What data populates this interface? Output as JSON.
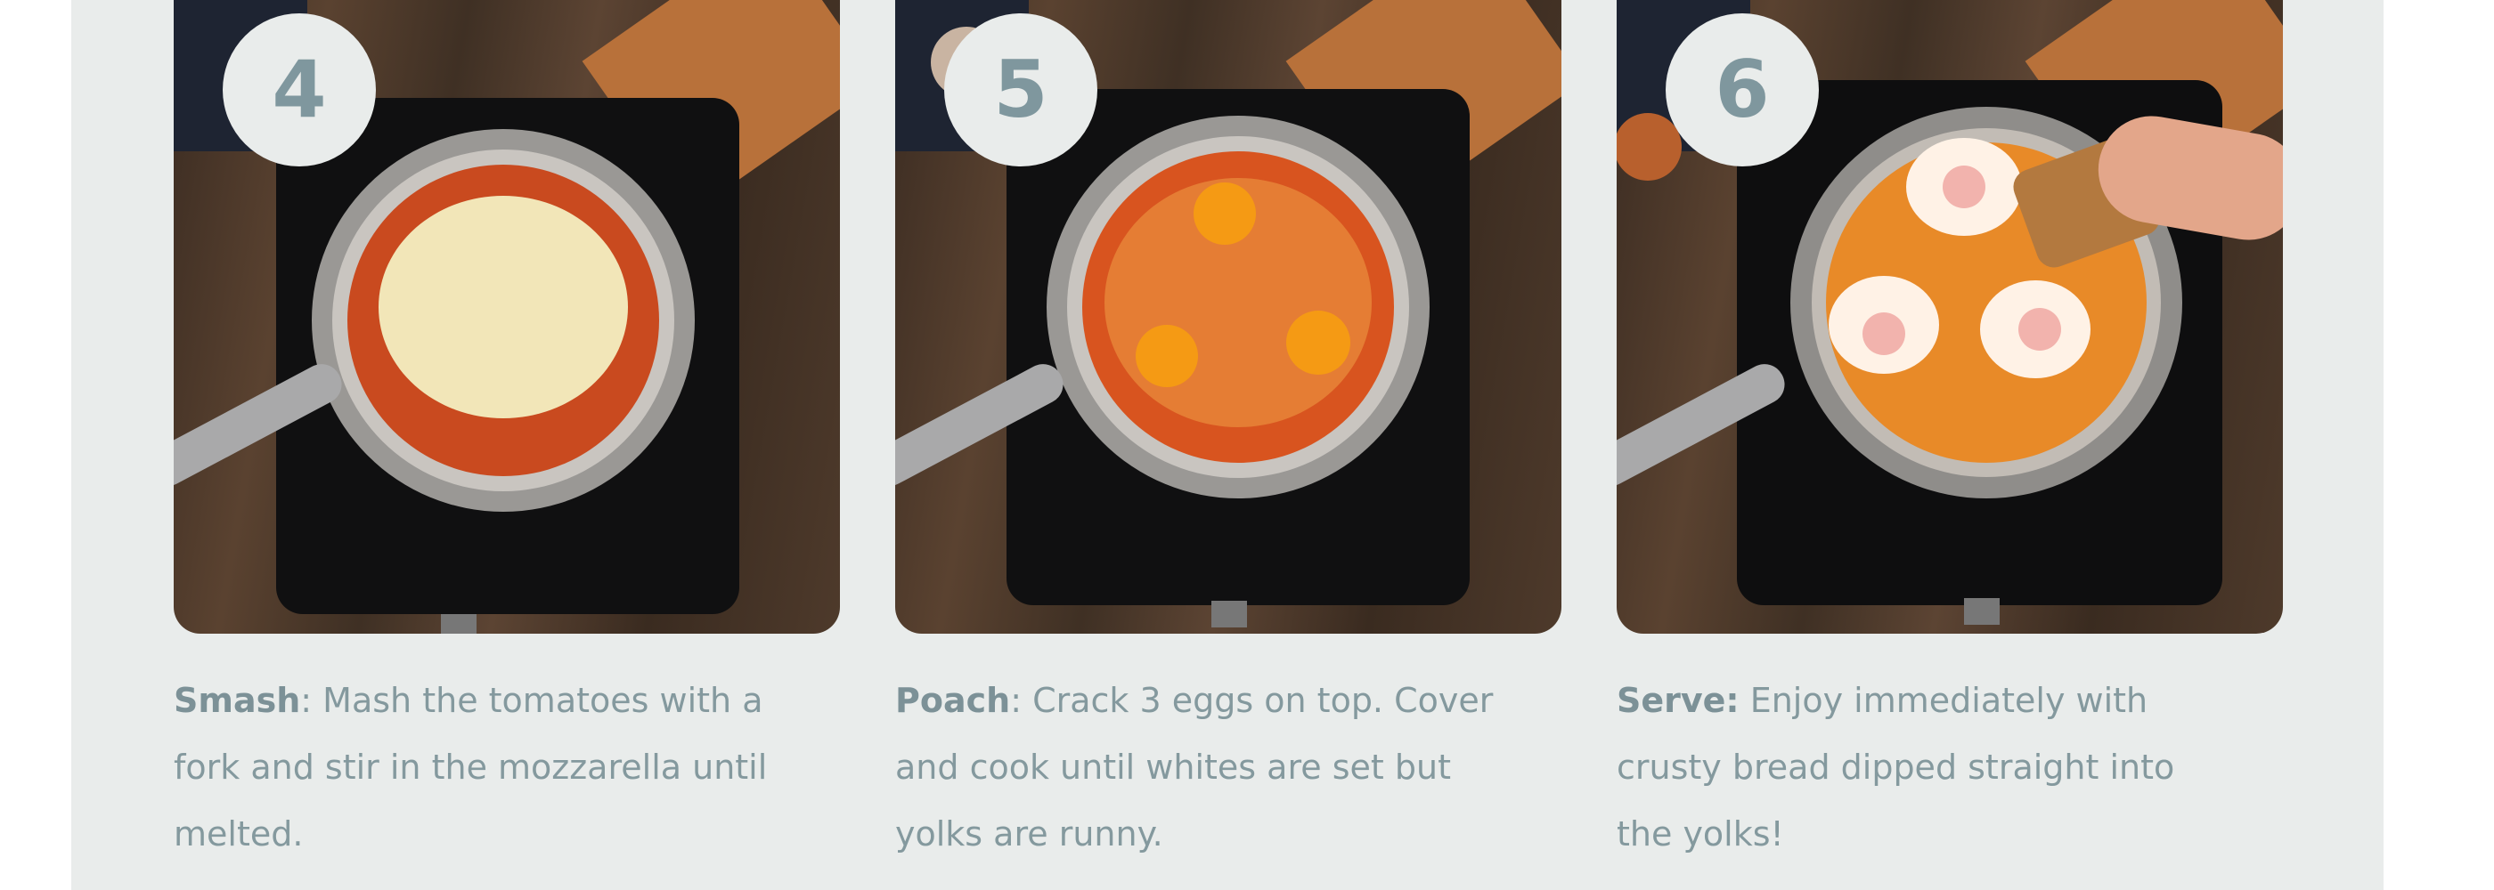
{
  "steps": [
    {
      "number": "4",
      "title": "Smash",
      "separator": ":",
      "body": " Mash the tomatoes with a fork and stir in the mozzarella until melted.",
      "photo_icon": "pan-cheese-photo"
    },
    {
      "number": "5",
      "title": "Poach",
      "separator": ":",
      "body": " Crack 3 eggs on top. Cover and cook until whites are set but yolks are runny.",
      "photo_icon": "pan-eggs-raw-photo"
    },
    {
      "number": "6",
      "title": "Serve:",
      "separator": "",
      "body": " Enjoy immediately with crusty bread dipped straight into the yolks!",
      "photo_icon": "pan-eggs-cooked-photo"
    }
  ],
  "colors": {
    "panel_bg": "#e9eceb",
    "text": "#84999e",
    "badge_text": "#7f979e"
  }
}
